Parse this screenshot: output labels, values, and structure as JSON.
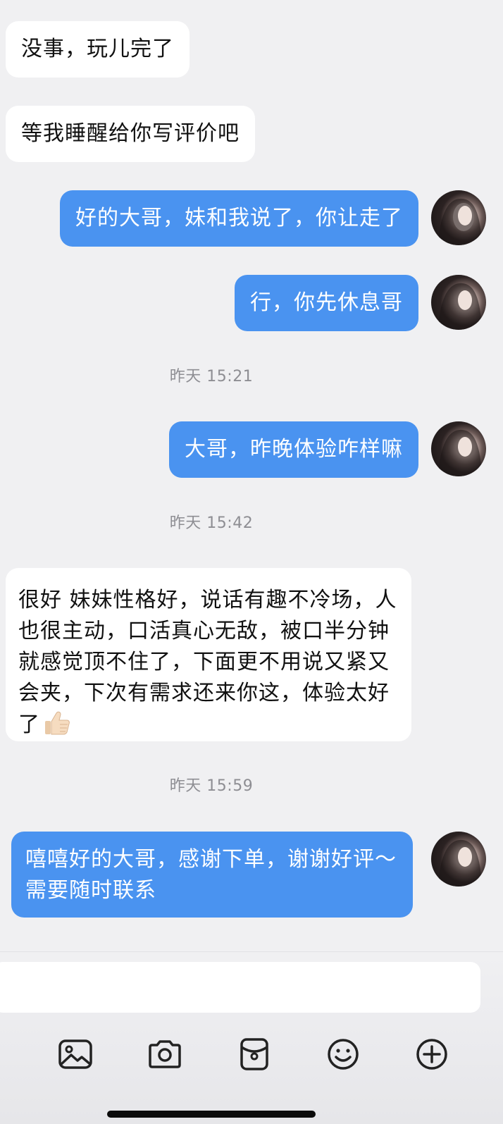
{
  "messages": {
    "m1": "没事，玩儿完了",
    "m2": "等我睡醒给你写评价吧",
    "m3": "好的大哥，妹和我说了，你让走了",
    "m4": "行，你先休息哥",
    "m5": "大哥，昨晚体验咋样嘛",
    "m6": "很好 妹妹性格好，说话有趣不冷场，人也很主动，口活真心无敌，被口半分钟就感觉顶不住了，下面更不用说又紧又会夹，下次有需求还来你这，体验太好了",
    "m7": "嘻嘻好的大哥，感谢下单，谢谢好评～需要随时联系"
  },
  "timestamps": {
    "t1": "昨天 15:21",
    "t2": "昨天 15:42",
    "t3": "昨天 15:59"
  },
  "input": {
    "placeholder": ""
  },
  "toolbar": {
    "icons": [
      "image-icon",
      "camera-icon",
      "red-packet-icon",
      "emoji-icon",
      "plus-icon"
    ]
  },
  "colors": {
    "outgoing_bubble": "#4a93f0",
    "incoming_bubble": "#ffffff",
    "background": "#f0f0f2",
    "timestamp_text": "#8e8e93"
  }
}
